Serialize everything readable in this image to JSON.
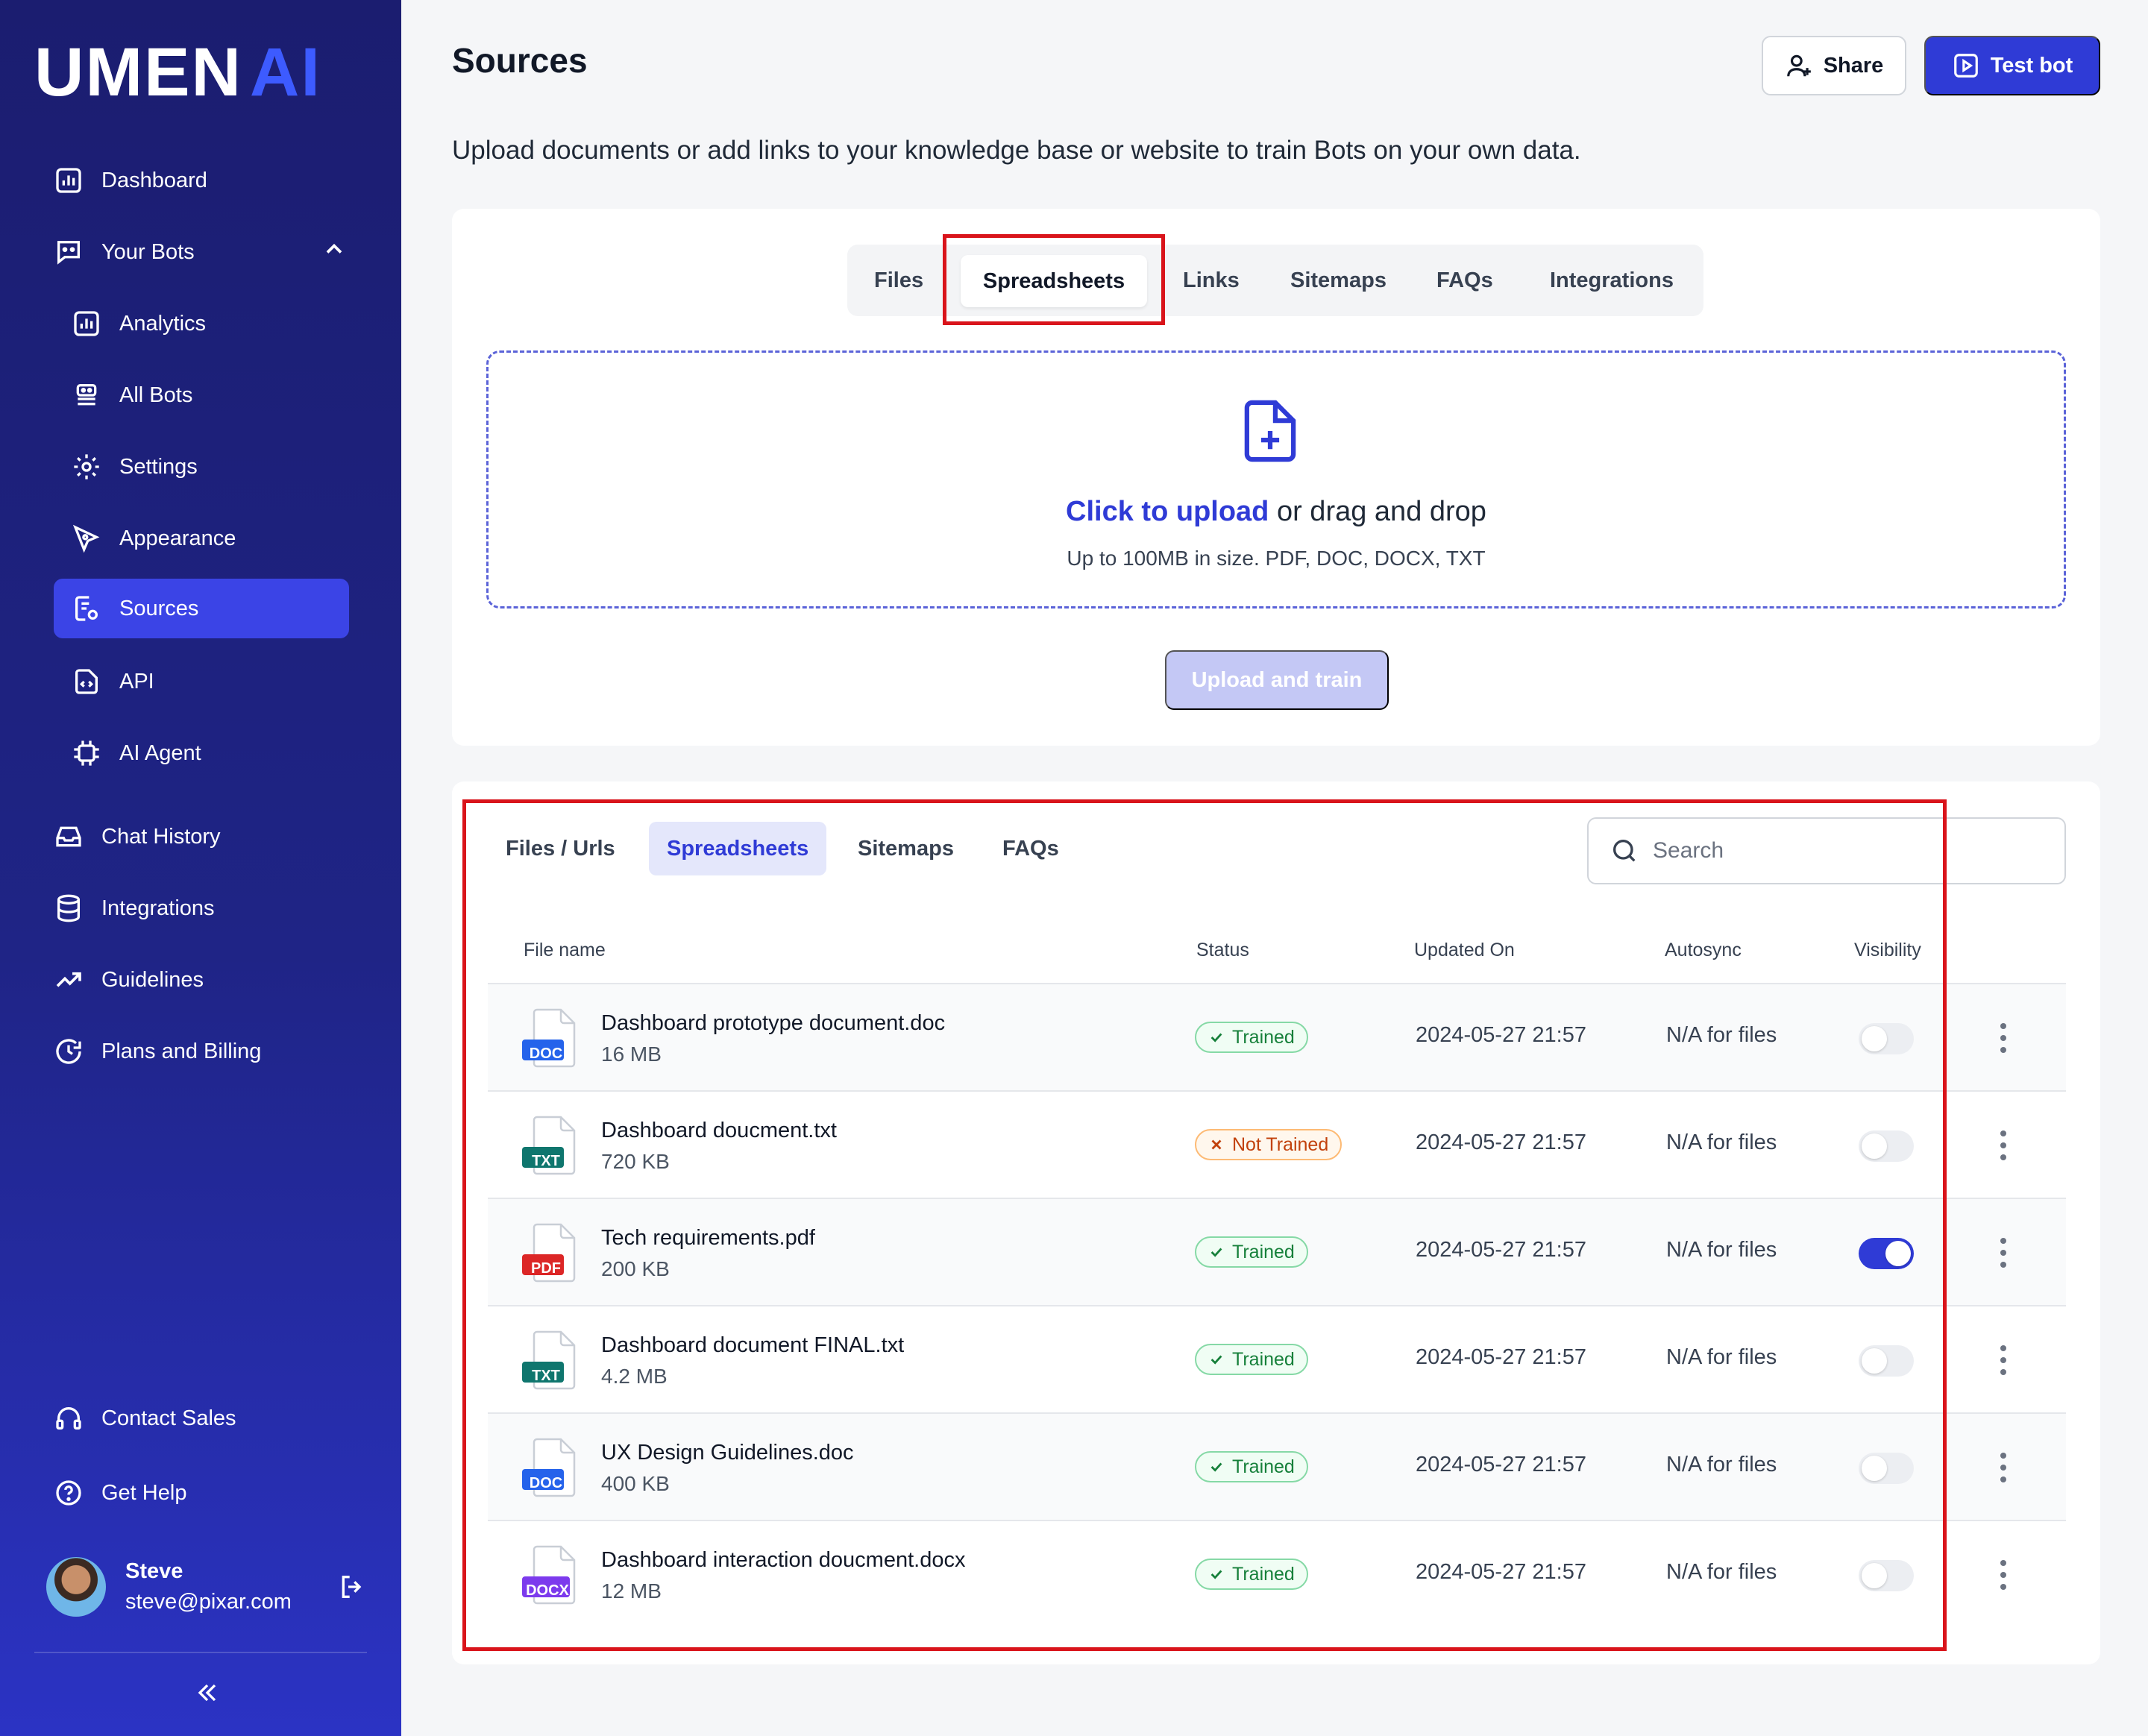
{
  "brand": {
    "logo_main": "UMEN",
    "logo_accent": "AI"
  },
  "sidebar": {
    "items": [
      {
        "label": "Dashboard",
        "icon": "chart-icon"
      },
      {
        "label": "Your Bots",
        "icon": "bot-chat-icon"
      },
      {
        "label": "Analytics",
        "icon": "chart-icon"
      },
      {
        "label": "All Bots",
        "icon": "robot-icon"
      },
      {
        "label": "Settings",
        "icon": "gear-icon"
      },
      {
        "label": "Appearance",
        "icon": "pen-icon"
      },
      {
        "label": "Sources",
        "icon": "document-gear-icon"
      },
      {
        "label": "API",
        "icon": "code-file-icon"
      },
      {
        "label": "AI Agent",
        "icon": "chip-icon"
      },
      {
        "label": "Chat History",
        "icon": "inbox-icon"
      },
      {
        "label": "Integrations",
        "icon": "database-icon"
      },
      {
        "label": "Guidelines",
        "icon": "trend-icon"
      },
      {
        "label": "Plans and Billing",
        "icon": "clock-icon"
      },
      {
        "label": "Contact Sales",
        "icon": "headset-icon"
      },
      {
        "label": "Get Help",
        "icon": "help-icon"
      }
    ],
    "active": "Sources",
    "user": {
      "name": "Steve",
      "email": "steve@pixar.com"
    }
  },
  "header": {
    "title": "Sources",
    "subtitle": "Upload documents or add links to your knowledge base or website to train Bots on your own data.",
    "share_label": "Share",
    "test_label": "Test bot"
  },
  "upload": {
    "tabs": [
      "Files",
      "Spreadsheets",
      "Links",
      "Sitemaps",
      "FAQs",
      "Integrations"
    ],
    "active_tab": "Spreadsheets",
    "click_text": "Click to upload",
    "drag_text": " or drag and drop",
    "hint": "Up to 100MB in size. PDF, DOC, DOCX, TXT",
    "button": "Upload and train"
  },
  "list": {
    "tabs": [
      "Files / Urls",
      "Spreadsheets",
      "Sitemaps",
      "FAQs"
    ],
    "active_tab": "Spreadsheets",
    "search_placeholder": "Search",
    "columns": [
      "File name",
      "Status",
      "Updated On",
      "Autosync",
      "Visibility"
    ],
    "rows": [
      {
        "type": "DOC",
        "name": "Dashboard prototype document.doc",
        "size": "16 MB",
        "status": "Trained",
        "updated": "2024-05-27 21:57",
        "autosync": "N/A for files",
        "visible": false
      },
      {
        "type": "TXT",
        "name": "Dashboard doucment.txt",
        "size": "720 KB",
        "status": "Not Trained",
        "updated": "2024-05-27 21:57",
        "autosync": "N/A for files",
        "visible": false
      },
      {
        "type": "PDF",
        "name": "Tech requirements.pdf",
        "size": "200 KB",
        "status": "Trained",
        "updated": "2024-05-27 21:57",
        "autosync": "N/A for files",
        "visible": true
      },
      {
        "type": "TXT",
        "name": "Dashboard document FINAL.txt",
        "size": "4.2 MB",
        "status": "Trained",
        "updated": "2024-05-27 21:57",
        "autosync": "N/A for files",
        "visible": false
      },
      {
        "type": "DOC",
        "name": "UX Design Guidelines.doc",
        "size": "400 KB",
        "status": "Trained",
        "updated": "2024-05-27 21:57",
        "autosync": "N/A for files",
        "visible": false
      },
      {
        "type": "DOCX",
        "name": "Dashboard interaction doucment.docx",
        "size": "12 MB",
        "status": "Trained",
        "updated": "2024-05-27 21:57",
        "autosync": "N/A for files",
        "visible": false
      }
    ]
  },
  "colors": {
    "accent": "#2f3bd6",
    "sidebar": "#1b1d70",
    "highlight": "#d9141b",
    "doc": "#2563eb",
    "txt": "#0f766e",
    "pdf": "#dc2626",
    "docx": "#7c3aed"
  }
}
